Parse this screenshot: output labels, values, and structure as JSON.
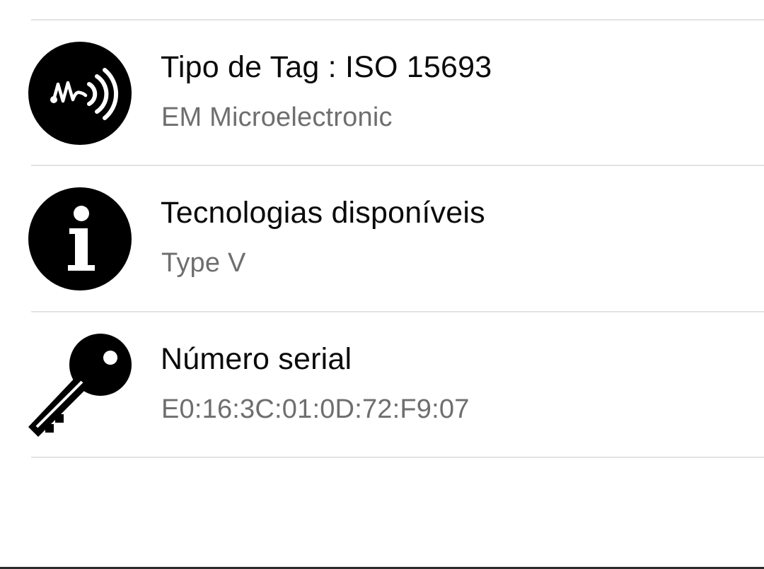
{
  "rows": [
    {
      "icon": "nfc-icon",
      "title": "Tipo de Tag : ISO 15693",
      "value": "EM Microelectronic"
    },
    {
      "icon": "info-icon",
      "title": "Tecnologias disponíveis",
      "value": "Type V"
    },
    {
      "icon": "key-icon",
      "title": "Número serial",
      "value": "E0:16:3C:01:0D:72:F9:07"
    }
  ],
  "colors": {
    "title": "#0a0a0a",
    "subtitle": "#6e6e6e",
    "icon": "#000000",
    "divider": "#e3e3e3",
    "background": "#ffffff"
  }
}
